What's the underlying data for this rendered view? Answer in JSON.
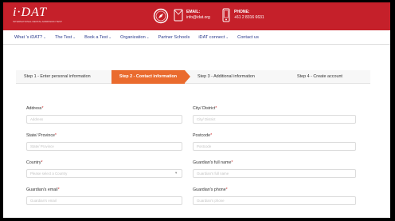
{
  "header": {
    "logo_text": "i·DAT",
    "logo_tagline": "INTERNATIONAL DENTAL ADMISSION TEST",
    "email_label": "EMAIL:",
    "email_value": "info@idat.org",
    "phone_label": "PHONE:",
    "phone_value": "+61 2 8316 6631",
    "brand_color": "#c5202a"
  },
  "nav": {
    "items": [
      {
        "label": "What 's iDAT?",
        "dropdown": true
      },
      {
        "label": "The Test",
        "dropdown": true
      },
      {
        "label": "Book a Test",
        "dropdown": true
      },
      {
        "label": "Organization",
        "dropdown": true
      },
      {
        "label": "Partner Schools",
        "dropdown": false
      },
      {
        "label": "iDAT connect",
        "dropdown": true
      },
      {
        "label": "Contact us",
        "dropdown": false
      }
    ],
    "caret": "⌄"
  },
  "steps": {
    "active_color": "#ea6b2e",
    "items": [
      {
        "label": "Step 1 - Enter personal information"
      },
      {
        "label": "Step 2 - Contact information"
      },
      {
        "label": "Step 3 - Additional information"
      },
      {
        "label": "Step 4 - Create account"
      }
    ],
    "active_index": 1
  },
  "form": {
    "required_mark": "*",
    "address": {
      "label": "Address",
      "placeholder": "Address"
    },
    "city": {
      "label": "City/ District",
      "placeholder": "City/ District"
    },
    "state": {
      "label": "State/ Province",
      "placeholder": "State/ Province"
    },
    "postcode": {
      "label": "Postcode",
      "placeholder": "Postcode"
    },
    "country": {
      "label": "Country",
      "placeholder": "Please select a Country",
      "caret": "▾"
    },
    "guardian_name": {
      "label": "Guardian's full name",
      "placeholder": "Guardian's full name"
    },
    "guardian_email": {
      "label": "Guardian's email",
      "placeholder": "Guardian's email"
    },
    "guardian_phone": {
      "label": "Guardian's phone",
      "placeholder": "Guardian's phone"
    }
  }
}
